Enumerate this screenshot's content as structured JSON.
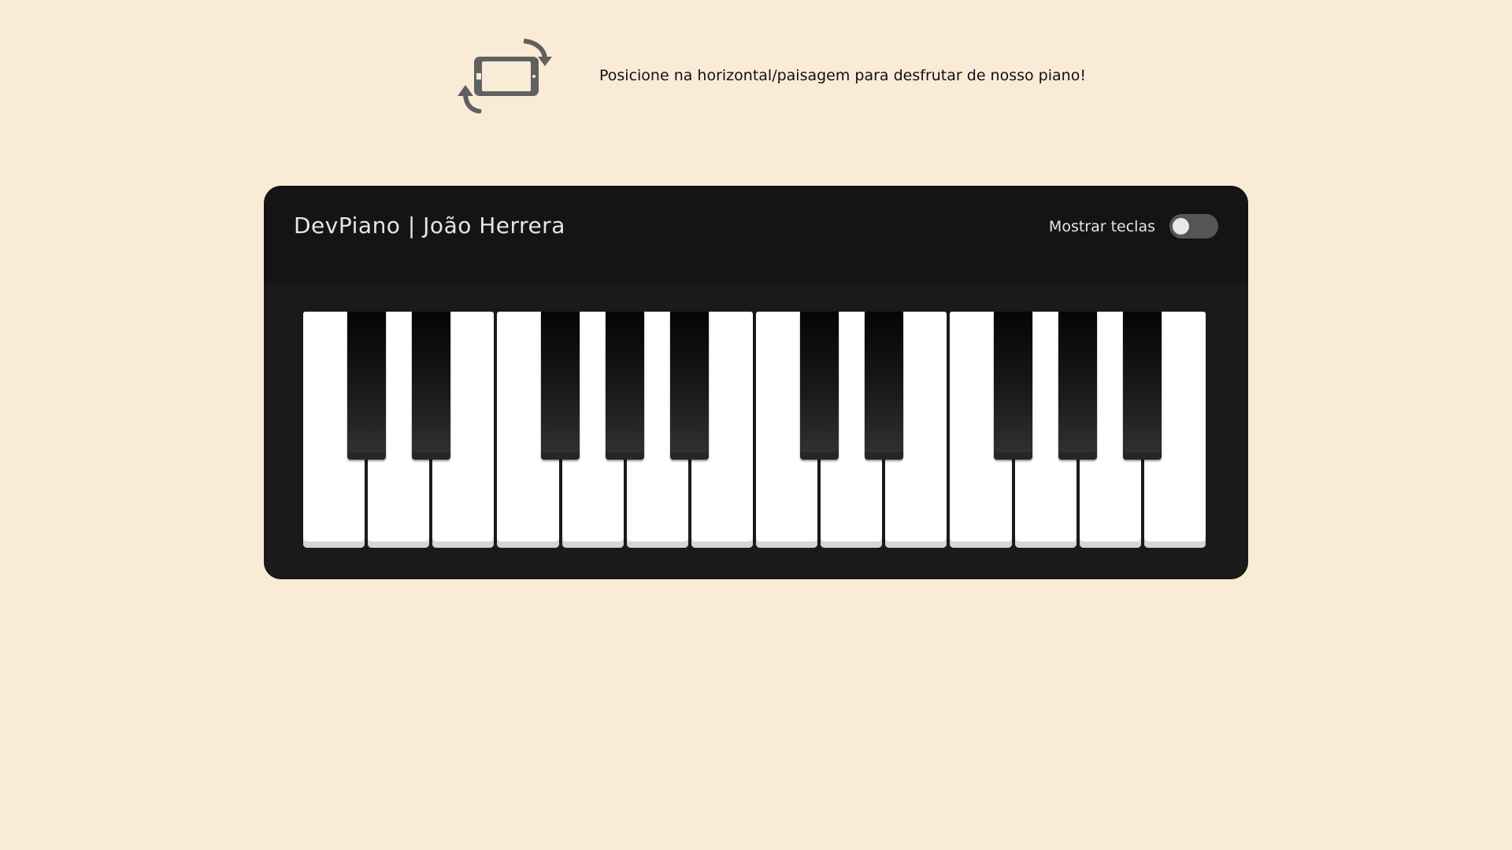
{
  "notice": {
    "icon": "rotate-device-icon",
    "text": "Posicione na horizontal/paisagem para desfrutar de nosso piano!"
  },
  "piano": {
    "title": "DevPiano | João Herrera",
    "toggle": {
      "label": "Mostrar teclas",
      "checked": false
    },
    "white_keys": [
      {
        "note": "c"
      },
      {
        "note": "d"
      },
      {
        "note": "e"
      },
      {
        "note": "f"
      },
      {
        "note": "g"
      },
      {
        "note": "a"
      },
      {
        "note": "b"
      },
      {
        "note": "c2"
      },
      {
        "note": "d2"
      },
      {
        "note": "e2"
      },
      {
        "note": "f2"
      },
      {
        "note": "g2"
      },
      {
        "note": "a2"
      },
      {
        "note": "b2"
      }
    ],
    "black_keys": [
      {
        "note": "c#",
        "after_white": 0
      },
      {
        "note": "d#",
        "after_white": 1
      },
      {
        "note": "f#",
        "after_white": 3
      },
      {
        "note": "g#",
        "after_white": 4
      },
      {
        "note": "a#",
        "after_white": 5
      },
      {
        "note": "c#2",
        "after_white": 7
      },
      {
        "note": "d#2",
        "after_white": 8
      },
      {
        "note": "f#2",
        "after_white": 10
      },
      {
        "note": "g#2",
        "after_white": 11
      },
      {
        "note": "a#2",
        "after_white": 12
      }
    ]
  },
  "colors": {
    "page_background": "#faebd7",
    "piano_body": "#141414",
    "toggle_track": "#555555"
  }
}
